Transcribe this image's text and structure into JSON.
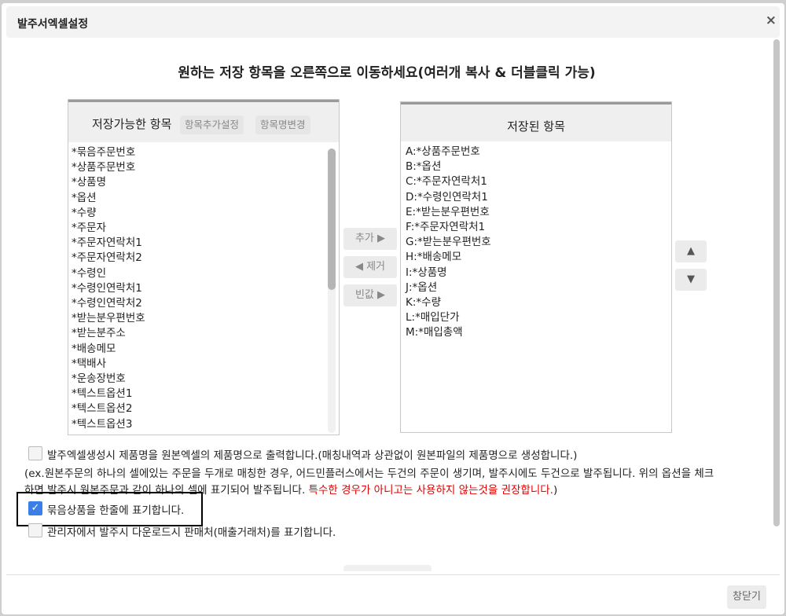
{
  "dialog": {
    "title": "발주서엑셀설정",
    "close_icon": "×",
    "heading": "원하는 저장 항목을 오른쪽으로 이동하세요(여러개 복사 & 더블클릭 가능)"
  },
  "left_panel": {
    "title": "저장가능한 항목",
    "btn_add_setting": "항목추가설정",
    "btn_rename": "항목명변경",
    "items": [
      "*묶음주문번호",
      "*상품주문번호",
      "*상품명",
      "*옵션",
      "*수량",
      "*주문자",
      "*주문자연락처1",
      "*주문자연락처2",
      "*수령인",
      "*수령인연락처1",
      "*수령인연락처2",
      "*받는분우편번호",
      "*받는분주소",
      "*배송메모",
      "*택배사",
      "*운송장번호",
      "*텍스트옵션1",
      "*텍스트옵션2",
      "*텍스트옵션3"
    ]
  },
  "middle": {
    "add": "추가 ▶",
    "remove": "◀ 제거",
    "empty": "빈값 ▶"
  },
  "right_panel": {
    "title": "저장된 항목",
    "items": [
      "A:*상품주문번호",
      "B:*옵션",
      "C:*주문자연락처1",
      "D:*수령인연락처1",
      "E:*받는분우편번호",
      "F:*주문자연락처1",
      "G:*받는분우편번호",
      "H:*배송메모",
      "I:*상품명",
      "J:*옵션",
      "K:*수량",
      "L:*매입단가",
      "M:*매입총액"
    ]
  },
  "sort": {
    "up": "▲",
    "down": "▼"
  },
  "options": {
    "opt1": "발주엑셀생성시 제품명을 원본엑셀의 제품명으로 출력합니다.(매칭내역과 상관없이 원본파일의 제품명으로 생성합니다.)",
    "note_line1": "(ex.원본주문의 하나의 셀에있는 주문을 두개로 매칭한 경우, 어드민플러스에서는 두건의 주문이 생기며, 발주시에도 두건으로 발주됩니다. 위의 옵션을 체크",
    "note_line2": "하면 발주시 원본주문과 같이 하나의 셀에 표기되어 발주됩니다. ",
    "note_warn": "특수한 경우가 아니고는 사용하지 않는것을 권장합니다.",
    "note_close": ")",
    "opt3": "묶음상품을 한줄에 표기합니다.",
    "opt3_checked": true,
    "opt4": "관리자에서 발주시 다운로드시 판매처(매출거래처)를 표기합니다."
  },
  "footer": {
    "close": "창닫기"
  }
}
